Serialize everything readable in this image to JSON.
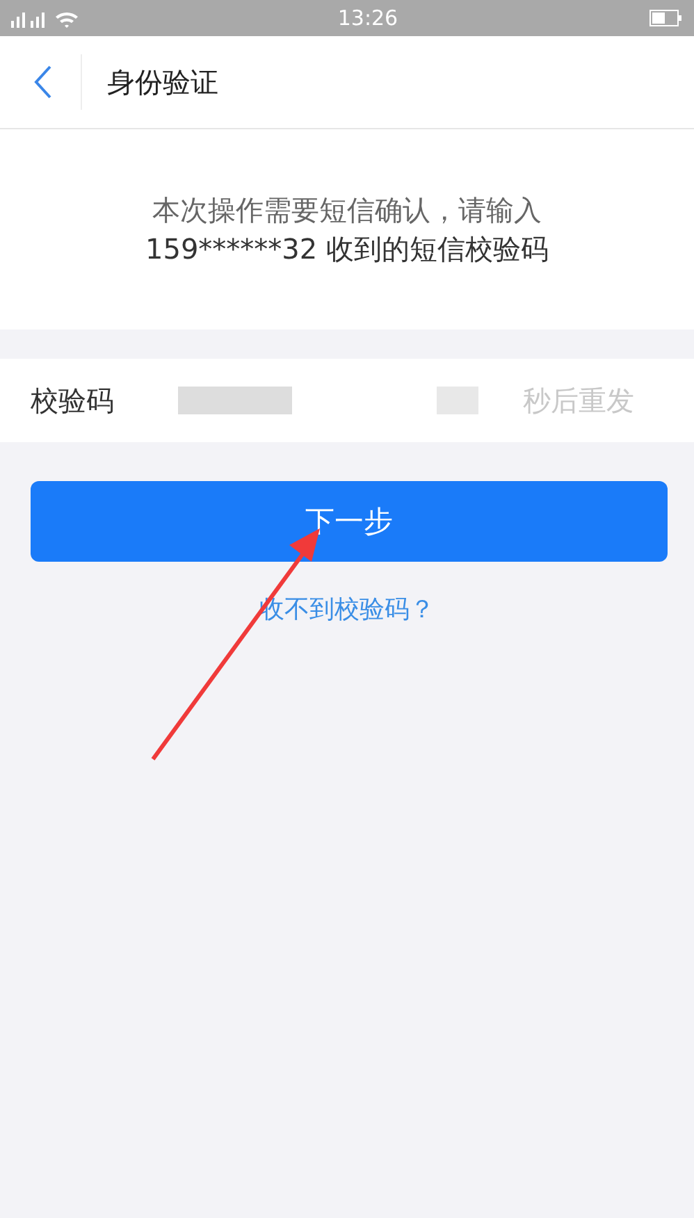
{
  "status_bar": {
    "time": "13:26"
  },
  "header": {
    "title": "身份验证"
  },
  "message": {
    "line_1": "本次操作需要短信确认，请输入",
    "line_2": "159******32 收到的短信校验码"
  },
  "code_row": {
    "label": "校验码",
    "resend": "秒后重发"
  },
  "next_button": "下一步",
  "help_link": "收不到校验码？"
}
